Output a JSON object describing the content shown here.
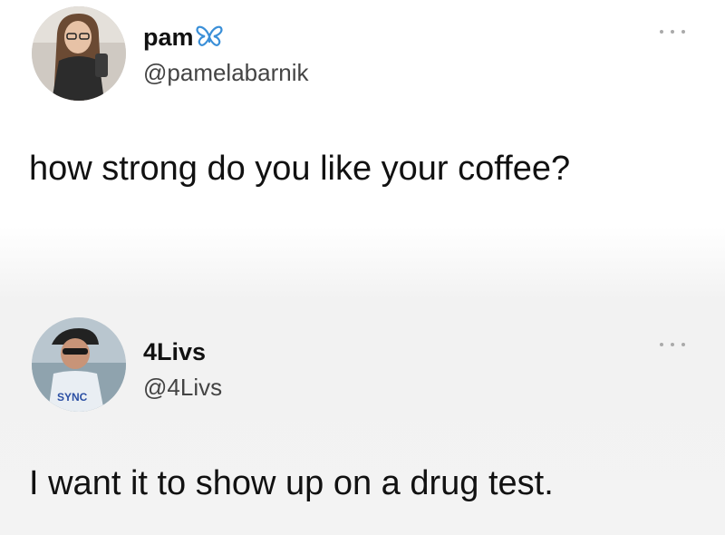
{
  "tweets": [
    {
      "display_name": "pam",
      "name_emoji_icon": "butterfly-icon",
      "handle": "@pamelabarnik",
      "text": "how strong do you like your coffee?"
    },
    {
      "display_name": "4Livs",
      "handle": "@4Livs",
      "text": "I want it to show up on a drug test."
    }
  ],
  "colors": {
    "butterfly": "#3a8fd8",
    "text": "#111111",
    "handle": "#444444",
    "more_dots": "#aaaaaa"
  }
}
